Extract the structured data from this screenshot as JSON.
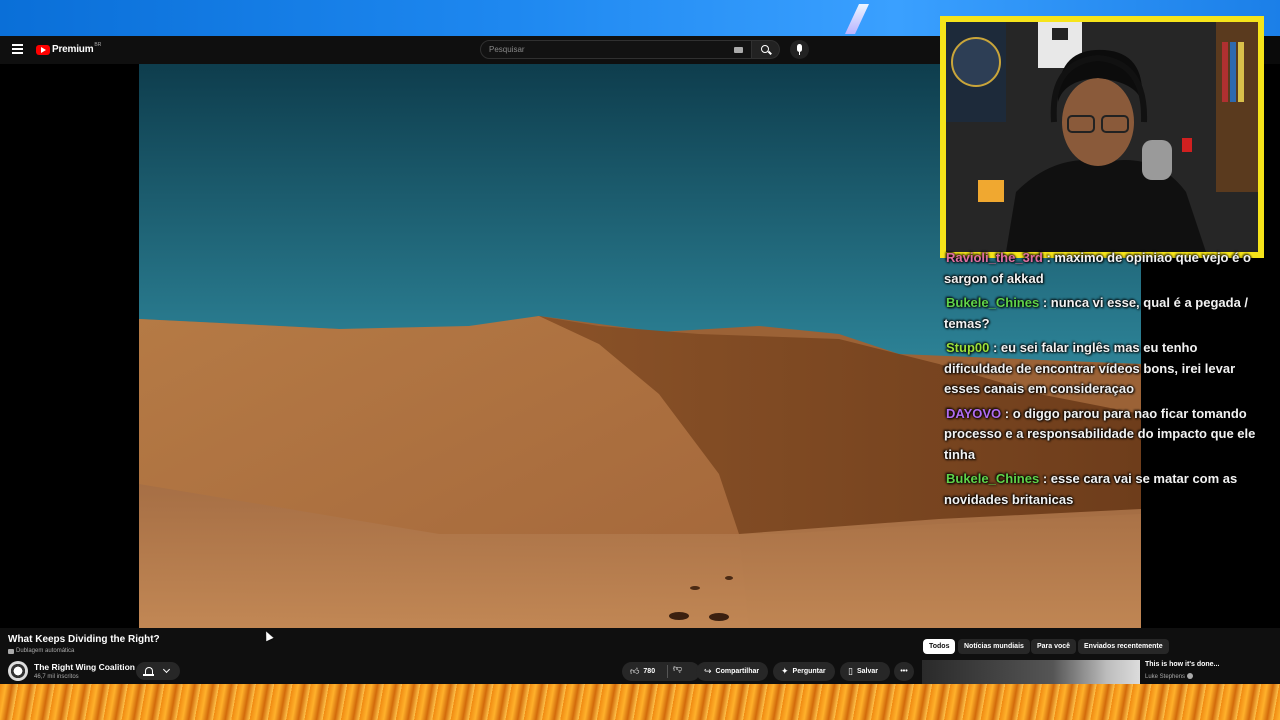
{
  "header": {
    "logo_text": "Premium",
    "logo_region": "BR",
    "search_placeholder": "Pesquisar"
  },
  "video": {
    "title": "What Keeps Dividing the Right?",
    "dub_label": "Dublagem automática",
    "channel": {
      "name": "The Right Wing Coalition",
      "subscribers": "46,7 mil inscritos"
    },
    "actions": {
      "likes": "780",
      "share": "Compartilhar",
      "ask": "Perguntar",
      "save": "Salvar",
      "more": "•••"
    }
  },
  "chips": [
    "Todos",
    "Notícias mundiais",
    "Para você",
    "Enviados recentemente"
  ],
  "recommendation": {
    "title": "This is how it's done...",
    "channel": "Luke Stephens"
  },
  "chat": {
    "messages": [
      {
        "user": "Ravioli_the_3rd",
        "color": "#e06fa0",
        "text": "maximo de opiniao que vejo é o sargon of akkad"
      },
      {
        "user": "Bukele_Chines",
        "color": "#5fd34a",
        "text": "nunca vi esse, qual é a pegada / temas?"
      },
      {
        "user": "Stup00",
        "color": "#9be03a",
        "text": "eu sei falar inglês mas eu tenho dificuldade de encontrar vídeos bons, irei levar esses canais em consideraçao"
      },
      {
        "user": "DAYOVO",
        "color": "#b06cf0",
        "text": "o diggo parou para nao ficar tomando processo e a responsabilidade do impacto que ele tinha"
      },
      {
        "user": "Bukele_Chines",
        "color": "#5fd34a",
        "text": "esse cara vai se matar com as novidades britanicas"
      }
    ]
  },
  "colors": {
    "webcam_border": "#f6e41a",
    "youtube_red": "#ff0000"
  }
}
